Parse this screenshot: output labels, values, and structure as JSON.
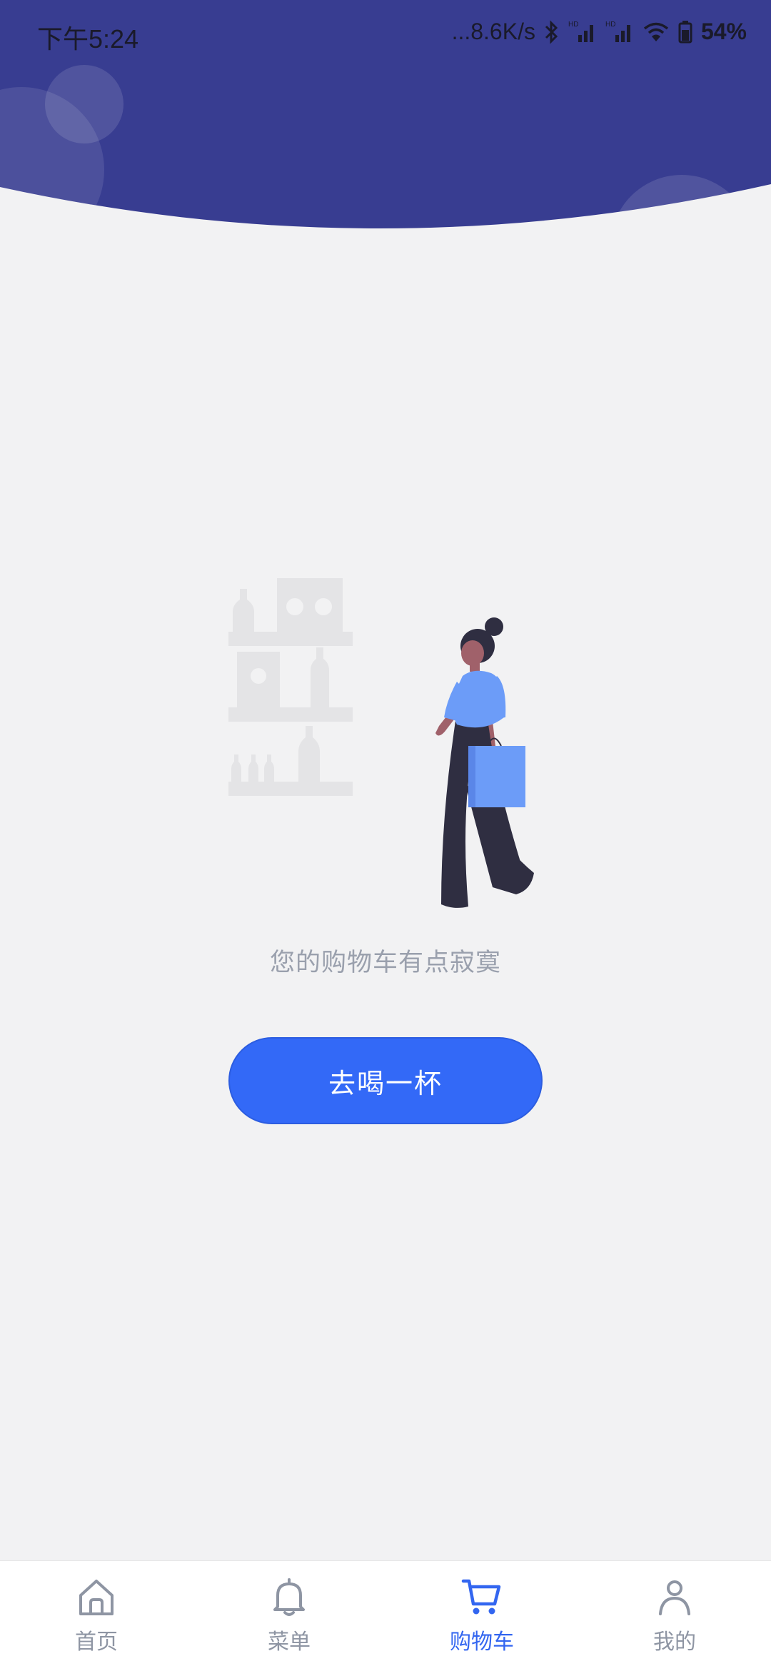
{
  "status_bar": {
    "time": "下午5:24",
    "network_speed": "...8.6K/s",
    "battery": "54%",
    "icons": [
      "bluetooth-icon",
      "signal-hd-icon",
      "signal-hd-icon",
      "wifi-icon",
      "battery-icon"
    ]
  },
  "colors": {
    "header": "#383d91",
    "accent": "#3369f7",
    "tab_active": "#3366f0",
    "tab_inactive": "#8e95a3",
    "background": "#f2f2f3"
  },
  "empty_state": {
    "message": "您的购物车有点寂寞",
    "button_label": "去喝一杯",
    "illustration": "woman-shopping-illustration"
  },
  "tabbar": {
    "items": [
      {
        "label": "首页",
        "icon": "home-icon",
        "active": false
      },
      {
        "label": "菜单",
        "icon": "bell-icon",
        "active": false
      },
      {
        "label": "购物车",
        "icon": "cart-icon",
        "active": true
      },
      {
        "label": "我的",
        "icon": "user-icon",
        "active": false
      }
    ]
  }
}
